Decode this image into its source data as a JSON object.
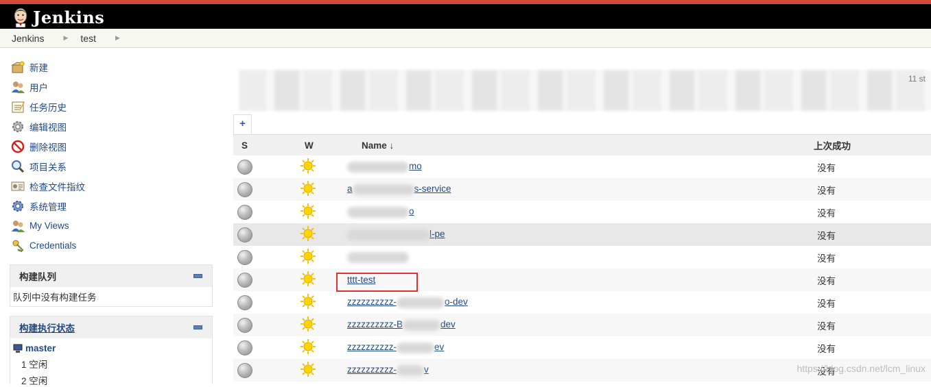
{
  "header": {
    "title": "Jenkins",
    "accent": "#d24939"
  },
  "breadcrumb": [
    {
      "label": "Jenkins"
    },
    {
      "label": "test"
    }
  ],
  "sidebar": {
    "tasks": [
      {
        "label": "新建",
        "icon": "new-item-icon"
      },
      {
        "label": "用户",
        "icon": "users-icon"
      },
      {
        "label": "任务历史",
        "icon": "notepad-icon"
      },
      {
        "label": "编辑视图",
        "icon": "gear-icon"
      },
      {
        "label": "删除视图",
        "icon": "no-entry-icon"
      },
      {
        "label": "项目关系",
        "icon": "magnifier-icon"
      },
      {
        "label": "检查文件指纹",
        "icon": "fingerprint-icon"
      },
      {
        "label": "系统管理",
        "icon": "gear-icon"
      },
      {
        "label": "My Views",
        "icon": "users-icon"
      },
      {
        "label": "Credentials",
        "icon": "key-icon"
      }
    ],
    "queue": {
      "title": "构建队列",
      "empty": "队列中没有构建任务"
    },
    "executors": {
      "title": "构建执行状态",
      "node": "master",
      "rows": [
        "1  空闲",
        "2  空闲"
      ]
    }
  },
  "main": {
    "blur_text": "11 st",
    "tab_add": "+",
    "columns": {
      "s": "S",
      "w": "W",
      "name": "Name  ↓",
      "last_success": "上次成功"
    },
    "jobs": [
      {
        "prefix": "",
        "suffix": "mo",
        "last": "没有"
      },
      {
        "prefix": "a",
        "suffix": "s-service",
        "last": "没有"
      },
      {
        "prefix": "",
        "suffix": "o",
        "last": "没有"
      },
      {
        "prefix": "",
        "suffix": "l-pe",
        "last": "没有"
      },
      {
        "prefix": "",
        "suffix": "",
        "last": "没有"
      },
      {
        "prefix": "tttt-test",
        "suffix": "",
        "last": "没有"
      },
      {
        "prefix": "zzzzzzzzzz-",
        "suffix": "o-dev",
        "last": "没有"
      },
      {
        "prefix": "zzzzzzzzzz-B",
        "suffix": "dev",
        "last": "没有"
      },
      {
        "prefix": "zzzzzzzzzz-",
        "suffix": "ev",
        "last": "没有"
      },
      {
        "prefix": "zzzzzzzzzz-",
        "suffix": "v",
        "last": "没有"
      }
    ]
  },
  "watermark": "https://blog.csdn.net/lcm_linux"
}
